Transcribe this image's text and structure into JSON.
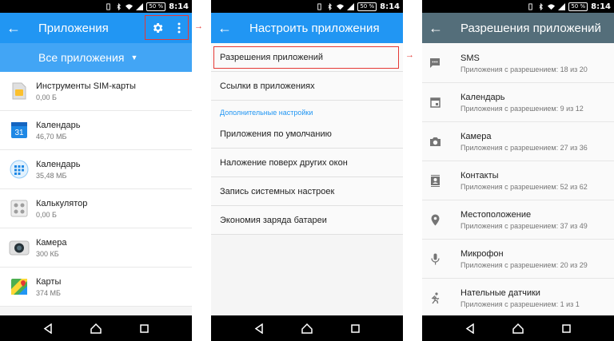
{
  "status": {
    "time": "8:14",
    "battery": "50 %"
  },
  "screen1": {
    "title": "Приложения",
    "dropdown_label": "Все приложения",
    "apps": [
      {
        "name": "Инструменты SIM-карты",
        "size": "0,00 Б",
        "icon": "sim-card-icon"
      },
      {
        "name": "Календарь",
        "size": "46,70 МБ",
        "icon": "calendar-icon",
        "icon_text": "31"
      },
      {
        "name": "Календарь",
        "size": "35,48 МБ",
        "icon": "calendar-grid-icon"
      },
      {
        "name": "Калькулятор",
        "size": "0,00 Б",
        "icon": "calculator-icon"
      },
      {
        "name": "Камера",
        "size": "300 КБ",
        "icon": "camera-app-icon"
      },
      {
        "name": "Карты",
        "size": "374 МБ",
        "icon": "maps-icon"
      }
    ]
  },
  "screen2": {
    "title": "Настроить приложения",
    "items_top": [
      "Разрешения приложений",
      "Ссылки в приложениях"
    ],
    "section_header": "Дополнительные настройки",
    "items_bottom": [
      "Приложения по умолчанию",
      "Наложение поверх других окон",
      "Запись системных настроек",
      "Экономия заряда батареи"
    ]
  },
  "screen3": {
    "title": "Разрешения приложений",
    "permissions": [
      {
        "name": "SMS",
        "detail": "Приложения с разрешением: 18 из 20",
        "icon": "sms-icon"
      },
      {
        "name": "Календарь",
        "detail": "Приложения с разрешением: 9 из 12",
        "icon": "calendar-icon"
      },
      {
        "name": "Камера",
        "detail": "Приложения с разрешением: 27 из 36",
        "icon": "camera-icon"
      },
      {
        "name": "Контакты",
        "detail": "Приложения с разрешением: 52 из 62",
        "icon": "contacts-icon"
      },
      {
        "name": "Местоположение",
        "detail": "Приложения с разрешением: 37 из 49",
        "icon": "location-icon"
      },
      {
        "name": "Микрофон",
        "detail": "Приложения с разрешением: 20 из 29",
        "icon": "microphone-icon"
      },
      {
        "name": "Нательные датчики",
        "detail": "Приложения с разрешением: 1 из 1",
        "icon": "body-sensors-icon"
      }
    ]
  },
  "colors": {
    "blue_appbar": "#2196f3",
    "blue_dropdown": "#42a5f5",
    "grey_appbar": "#546e7a",
    "highlight": "#e53935"
  }
}
